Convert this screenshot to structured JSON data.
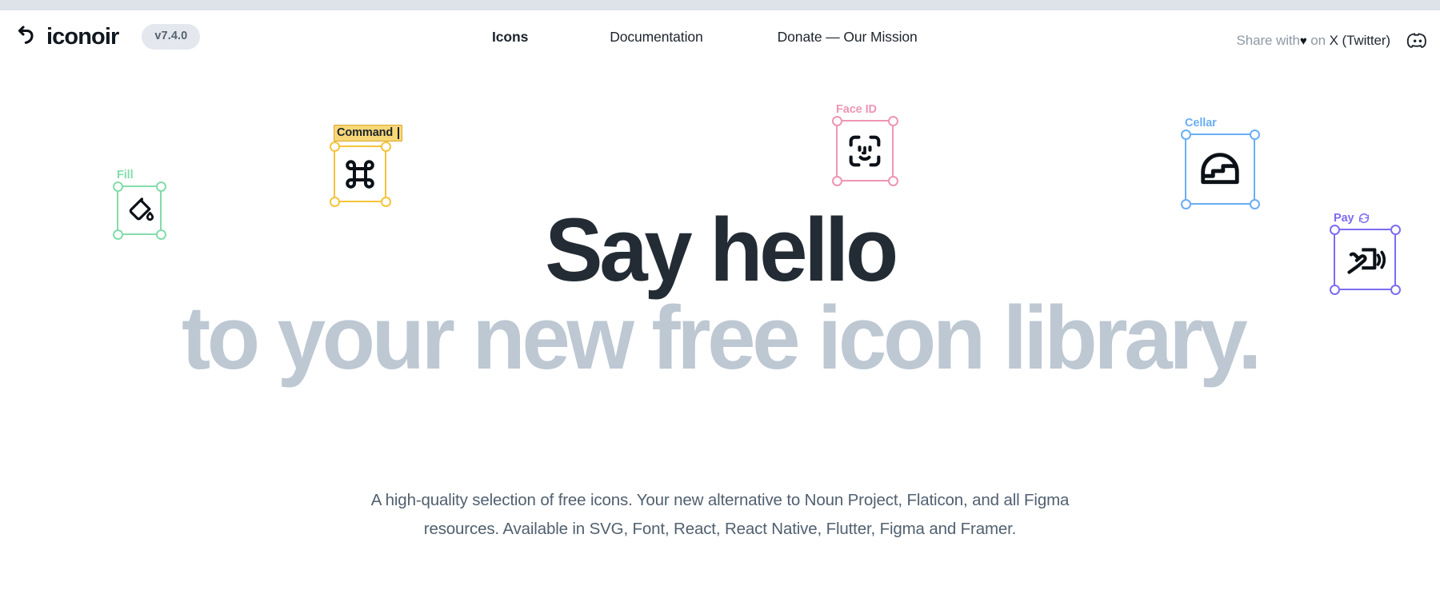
{
  "header": {
    "logo_icon": "undo-arrow-icon",
    "logo_text": "iconoir",
    "version": "v7.4.0",
    "nav": [
      {
        "label": "Icons",
        "active": true
      },
      {
        "label": "Documentation",
        "active": false
      },
      {
        "label": "Donate — Our Mission",
        "active": false
      }
    ],
    "share": {
      "prefix": "Share with",
      "heart": "♥",
      "middle": "on",
      "target": "X (Twitter)"
    },
    "discord_icon": "discord-icon"
  },
  "hero": {
    "line1": "Say hello",
    "line2": "to your new free icon library.",
    "subtitle": "A high-quality selection of free icons. Your new alternative to Noun Project, Flaticon, and all Figma resources. Available in SVG, Font, React, React Native, Flutter, Figma and Framer."
  },
  "icon_cards": [
    {
      "id": "fill",
      "label": "Fill",
      "icon": "paint-bucket-icon",
      "color": "#84dcab",
      "selected_label": false,
      "badge": null
    },
    {
      "id": "command",
      "label": "Command",
      "icon": "command-key-icon",
      "color": "#f5c33b",
      "selected_label": true,
      "badge": null
    },
    {
      "id": "faceid",
      "label": "Face ID",
      "icon": "face-id-icon",
      "color": "#ef95b5",
      "selected_label": false,
      "badge": null
    },
    {
      "id": "cellar",
      "label": "Cellar",
      "icon": "cellar-stairs-icon",
      "color": "#6aaef4",
      "selected_label": false,
      "badge": null
    },
    {
      "id": "pay",
      "label": "Pay",
      "icon": "contactless-pay-icon",
      "color": "#7c6cf2",
      "selected_label": false,
      "badge": "refresh-icon"
    }
  ],
  "colors": {
    "top_strip": "#dee3ea",
    "headline_dark": "#232c35",
    "headline_light": "#bdc8d3",
    "subtitle": "#51606f",
    "badge_bg": "#e4e8ee",
    "nav_text": "#1d242c",
    "share_text": "#8e99a6"
  }
}
